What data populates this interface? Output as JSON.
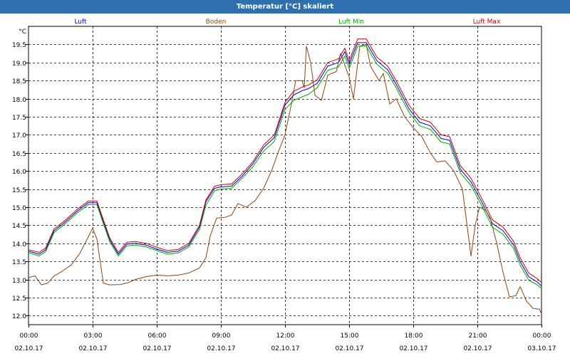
{
  "window": {
    "title": "Temperatur [°C] skaliert"
  },
  "chart_data": {
    "type": "line",
    "title": "Temperatur [°C] skaliert",
    "ylabel": "°C",
    "xlabel": "",
    "ylim": [
      11.75,
      20.0
    ],
    "xlim": [
      0,
      24
    ],
    "grid": true,
    "y_ticks": [
      12.0,
      12.5,
      13.0,
      13.5,
      14.0,
      14.5,
      15.0,
      15.5,
      16.0,
      16.5,
      17.0,
      17.5,
      18.0,
      18.5,
      19.0,
      19.5
    ],
    "x_ticks": [
      {
        "x": 0,
        "time": "00:00",
        "date": "02.10.17"
      },
      {
        "x": 3,
        "time": "03:00",
        "date": "02.10.17"
      },
      {
        "x": 6,
        "time": "06:00",
        "date": "02.10.17"
      },
      {
        "x": 9,
        "time": "09:00",
        "date": "02.10.17"
      },
      {
        "x": 12,
        "time": "12:00",
        "date": "02.10.17"
      },
      {
        "x": 15,
        "time": "15:00",
        "date": "02.10.17"
      },
      {
        "x": 18,
        "time": "18:00",
        "date": "02.10.17"
      },
      {
        "x": 21,
        "time": "21:00",
        "date": "02.10.17"
      },
      {
        "x": 24,
        "time": "00:00",
        "date": "03.10.17"
      }
    ],
    "series": [
      {
        "name": "Luft",
        "color": "#0000cc",
        "points": [
          [
            0,
            13.78
          ],
          [
            0.5,
            13.7
          ],
          [
            0.8,
            13.82
          ],
          [
            1.2,
            14.35
          ],
          [
            1.7,
            14.58
          ],
          [
            2.3,
            14.9
          ],
          [
            2.8,
            15.12
          ],
          [
            3.2,
            15.12
          ],
          [
            3.5,
            14.6
          ],
          [
            3.8,
            14.1
          ],
          [
            4.2,
            13.7
          ],
          [
            4.6,
            13.98
          ],
          [
            5.0,
            14.0
          ],
          [
            5.5,
            13.95
          ],
          [
            6.0,
            13.84
          ],
          [
            6.5,
            13.75
          ],
          [
            7.0,
            13.78
          ],
          [
            7.5,
            13.95
          ],
          [
            8.0,
            14.45
          ],
          [
            8.3,
            15.15
          ],
          [
            8.7,
            15.52
          ],
          [
            9.0,
            15.56
          ],
          [
            9.5,
            15.58
          ],
          [
            10.0,
            15.86
          ],
          [
            10.5,
            16.2
          ],
          [
            11.0,
            16.65
          ],
          [
            11.5,
            16.92
          ],
          [
            12.0,
            17.82
          ],
          [
            12.4,
            18.1
          ],
          [
            12.8,
            18.22
          ],
          [
            13.1,
            18.28
          ],
          [
            13.5,
            18.42
          ],
          [
            14.0,
            18.9
          ],
          [
            14.5,
            19.0
          ],
          [
            14.8,
            19.3
          ],
          [
            15.0,
            18.95
          ],
          [
            15.4,
            19.55
          ],
          [
            15.8,
            19.55
          ],
          [
            16.3,
            19.05
          ],
          [
            16.8,
            18.8
          ],
          [
            17.2,
            18.4
          ],
          [
            17.8,
            17.72
          ],
          [
            18.3,
            17.35
          ],
          [
            18.8,
            17.25
          ],
          [
            19.3,
            16.9
          ],
          [
            19.7,
            16.85
          ],
          [
            20.2,
            16.05
          ],
          [
            20.7,
            15.7
          ],
          [
            21.2,
            15.15
          ],
          [
            21.7,
            14.55
          ],
          [
            22.2,
            14.35
          ],
          [
            22.7,
            13.95
          ],
          [
            23.0,
            13.5
          ],
          [
            23.4,
            13.08
          ],
          [
            23.8,
            12.93
          ],
          [
            24.0,
            12.82
          ]
        ]
      },
      {
        "name": "Boden",
        "color": "#8b4513",
        "points": [
          [
            0,
            13.05
          ],
          [
            0.3,
            13.1
          ],
          [
            0.6,
            12.85
          ],
          [
            0.9,
            12.9
          ],
          [
            1.2,
            13.1
          ],
          [
            1.5,
            13.2
          ],
          [
            2.0,
            13.4
          ],
          [
            2.4,
            13.72
          ],
          [
            2.8,
            14.18
          ],
          [
            3.0,
            14.42
          ],
          [
            3.2,
            14.12
          ],
          [
            3.5,
            12.9
          ],
          [
            3.8,
            12.85
          ],
          [
            4.3,
            12.86
          ],
          [
            4.7,
            12.92
          ],
          [
            5.0,
            13.0
          ],
          [
            5.5,
            13.08
          ],
          [
            6.0,
            13.12
          ],
          [
            6.5,
            13.1
          ],
          [
            7.0,
            13.12
          ],
          [
            7.5,
            13.18
          ],
          [
            8.0,
            13.32
          ],
          [
            8.3,
            13.6
          ],
          [
            8.5,
            14.2
          ],
          [
            8.8,
            14.7
          ],
          [
            9.2,
            14.72
          ],
          [
            9.5,
            14.78
          ],
          [
            9.8,
            15.1
          ],
          [
            10.2,
            15.0
          ],
          [
            10.6,
            15.18
          ],
          [
            11.0,
            15.52
          ],
          [
            11.4,
            16.05
          ],
          [
            11.7,
            16.55
          ],
          [
            12.0,
            17.0
          ],
          [
            12.3,
            17.85
          ],
          [
            12.5,
            18.5
          ],
          [
            12.8,
            18.5
          ],
          [
            12.9,
            18.3
          ],
          [
            13.0,
            19.45
          ],
          [
            13.2,
            19.0
          ],
          [
            13.4,
            18.1
          ],
          [
            13.7,
            17.95
          ],
          [
            14.0,
            18.65
          ],
          [
            14.4,
            18.75
          ],
          [
            14.6,
            19.25
          ],
          [
            15.0,
            18.6
          ],
          [
            15.2,
            18.0
          ],
          [
            15.5,
            19.45
          ],
          [
            15.8,
            19.5
          ],
          [
            16.0,
            18.9
          ],
          [
            16.4,
            18.5
          ],
          [
            16.6,
            18.7
          ],
          [
            16.9,
            17.85
          ],
          [
            17.2,
            18.0
          ],
          [
            17.6,
            17.5
          ],
          [
            18.0,
            17.2
          ],
          [
            18.4,
            16.95
          ],
          [
            18.8,
            16.5
          ],
          [
            19.1,
            16.25
          ],
          [
            19.5,
            16.28
          ],
          [
            19.9,
            16.0
          ],
          [
            20.3,
            15.5
          ],
          [
            20.7,
            13.65
          ],
          [
            20.9,
            14.5
          ],
          [
            21.1,
            15.0
          ],
          [
            21.4,
            14.9
          ],
          [
            21.6,
            14.7
          ],
          [
            21.9,
            14.02
          ],
          [
            22.2,
            13.2
          ],
          [
            22.5,
            12.52
          ],
          [
            22.8,
            12.55
          ],
          [
            23.0,
            12.8
          ],
          [
            23.3,
            12.4
          ],
          [
            23.6,
            12.2
          ],
          [
            23.9,
            12.18
          ],
          [
            24.0,
            12.05
          ]
        ]
      },
      {
        "name": "Luft Min",
        "color": "#00aa00",
        "points": [
          [
            0,
            13.74
          ],
          [
            0.5,
            13.65
          ],
          [
            0.8,
            13.77
          ],
          [
            1.2,
            14.3
          ],
          [
            1.7,
            14.53
          ],
          [
            2.3,
            14.85
          ],
          [
            2.8,
            15.07
          ],
          [
            3.2,
            15.07
          ],
          [
            3.5,
            14.55
          ],
          [
            3.8,
            14.05
          ],
          [
            4.2,
            13.65
          ],
          [
            4.6,
            13.93
          ],
          [
            5.0,
            13.95
          ],
          [
            5.5,
            13.9
          ],
          [
            6.0,
            13.8
          ],
          [
            6.5,
            13.7
          ],
          [
            7.0,
            13.73
          ],
          [
            7.5,
            13.9
          ],
          [
            8.0,
            14.38
          ],
          [
            8.3,
            15.05
          ],
          [
            8.7,
            15.45
          ],
          [
            9.0,
            15.5
          ],
          [
            9.5,
            15.52
          ],
          [
            10.0,
            15.8
          ],
          [
            10.5,
            16.12
          ],
          [
            11.0,
            16.55
          ],
          [
            11.5,
            16.82
          ],
          [
            12.0,
            17.7
          ],
          [
            12.4,
            17.95
          ],
          [
            12.8,
            18.05
          ],
          [
            13.1,
            18.12
          ],
          [
            13.5,
            18.3
          ],
          [
            14.0,
            18.78
          ],
          [
            14.5,
            18.88
          ],
          [
            14.8,
            19.18
          ],
          [
            15.0,
            18.83
          ],
          [
            15.4,
            19.45
          ],
          [
            15.8,
            19.45
          ],
          [
            16.3,
            18.95
          ],
          [
            16.8,
            18.7
          ],
          [
            17.2,
            18.3
          ],
          [
            17.8,
            17.62
          ],
          [
            18.3,
            17.25
          ],
          [
            18.8,
            17.15
          ],
          [
            19.3,
            16.8
          ],
          [
            19.7,
            16.75
          ],
          [
            20.2,
            15.95
          ],
          [
            20.7,
            15.6
          ],
          [
            21.2,
            15.05
          ],
          [
            21.7,
            14.45
          ],
          [
            22.2,
            14.25
          ],
          [
            22.7,
            13.85
          ],
          [
            23.0,
            13.4
          ],
          [
            23.4,
            12.98
          ],
          [
            23.8,
            12.85
          ],
          [
            24.0,
            12.75
          ]
        ]
      },
      {
        "name": "Luft Max",
        "color": "#cc0000",
        "points": [
          [
            0,
            13.82
          ],
          [
            0.5,
            13.75
          ],
          [
            0.8,
            13.87
          ],
          [
            1.2,
            14.4
          ],
          [
            1.7,
            14.63
          ],
          [
            2.3,
            14.95
          ],
          [
            2.8,
            15.17
          ],
          [
            3.2,
            15.17
          ],
          [
            3.5,
            14.65
          ],
          [
            3.8,
            14.15
          ],
          [
            4.2,
            13.75
          ],
          [
            4.6,
            14.03
          ],
          [
            5.0,
            14.05
          ],
          [
            5.5,
            14.0
          ],
          [
            6.0,
            13.89
          ],
          [
            6.5,
            13.8
          ],
          [
            7.0,
            13.83
          ],
          [
            7.5,
            14.0
          ],
          [
            8.0,
            14.5
          ],
          [
            8.3,
            15.2
          ],
          [
            8.7,
            15.58
          ],
          [
            9.0,
            15.62
          ],
          [
            9.5,
            15.64
          ],
          [
            10.0,
            15.92
          ],
          [
            10.5,
            16.26
          ],
          [
            11.0,
            16.72
          ],
          [
            11.5,
            17.0
          ],
          [
            12.0,
            17.9
          ],
          [
            12.4,
            18.2
          ],
          [
            12.8,
            18.32
          ],
          [
            13.1,
            18.38
          ],
          [
            13.5,
            18.52
          ],
          [
            14.0,
            19.0
          ],
          [
            14.5,
            19.1
          ],
          [
            14.8,
            19.4
          ],
          [
            15.0,
            19.05
          ],
          [
            15.4,
            19.65
          ],
          [
            15.8,
            19.65
          ],
          [
            16.3,
            19.15
          ],
          [
            16.8,
            18.9
          ],
          [
            17.2,
            18.5
          ],
          [
            17.8,
            17.82
          ],
          [
            18.3,
            17.45
          ],
          [
            18.8,
            17.35
          ],
          [
            19.3,
            17.0
          ],
          [
            19.7,
            16.95
          ],
          [
            20.2,
            16.15
          ],
          [
            20.7,
            15.8
          ],
          [
            21.2,
            15.25
          ],
          [
            21.7,
            14.65
          ],
          [
            22.2,
            14.45
          ],
          [
            22.7,
            14.05
          ],
          [
            23.0,
            13.6
          ],
          [
            23.4,
            13.18
          ],
          [
            23.8,
            13.02
          ],
          [
            24.0,
            12.92
          ]
        ]
      }
    ]
  }
}
